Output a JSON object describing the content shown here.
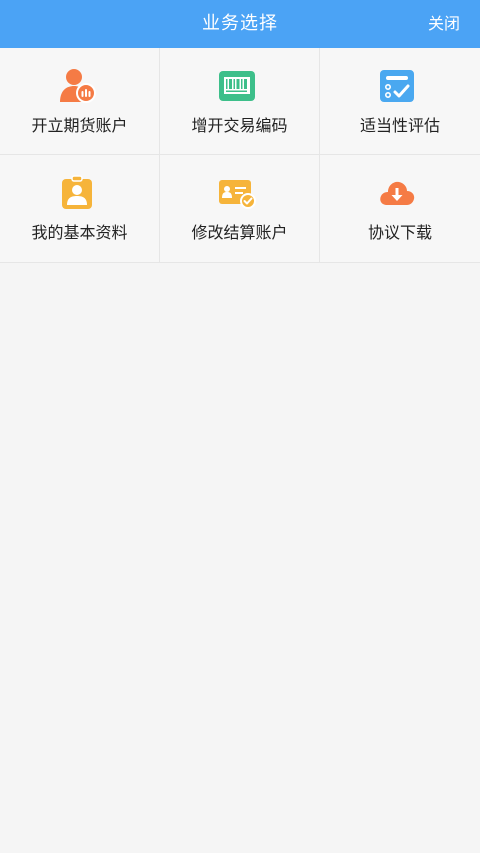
{
  "header": {
    "title": "业务选择",
    "close_label": "关闭"
  },
  "menu": [
    {
      "label": "开立期货账户",
      "icon": "user-coins-icon"
    },
    {
      "label": "增开交易编码",
      "icon": "barcode-icon"
    },
    {
      "label": "适当性评估",
      "icon": "checklist-icon"
    },
    {
      "label": "我的基本资料",
      "icon": "id-badge-icon"
    },
    {
      "label": "修改结算账户",
      "icon": "card-check-icon"
    },
    {
      "label": "协议下载",
      "icon": "cloud-download-icon"
    }
  ],
  "colors": {
    "header_bg": "#4ba3f5",
    "orange": "#f57b45",
    "green": "#3dbf8a",
    "blue": "#4aa8f0",
    "yellow": "#f6b43a"
  }
}
